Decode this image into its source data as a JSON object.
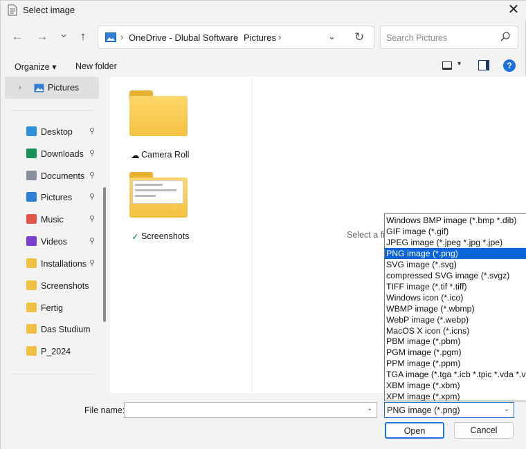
{
  "window": {
    "title": "Select image",
    "close_symbol": "✕"
  },
  "nav": {
    "back_symbol": "←",
    "forward_symbol": "→",
    "recent_symbol": "⌄",
    "up_symbol": "↑",
    "breadcrumbs": [
      "OneDrive - Dlubal Software",
      "Pictures"
    ],
    "crumb_sep": "›",
    "dropdown_symbol": "⌄",
    "refresh_symbol": "↻",
    "search_placeholder": "Search Pictures"
  },
  "command_bar": {
    "organize_label": "Organize ▾",
    "new_folder_label": "New folder",
    "view_dropdown_symbol": "▾",
    "help_symbol": "?"
  },
  "sidebar": {
    "selected": {
      "chevron": "›",
      "label": "Pictures"
    },
    "items": [
      {
        "label": "Desktop",
        "icon": "desktop-icon",
        "color": "#2f8fd8",
        "pinned": true
      },
      {
        "label": "Downloads",
        "icon": "download-icon",
        "color": "#1a8f5a",
        "pinned": true
      },
      {
        "label": "Documents",
        "icon": "document-icon",
        "color": "#8a8fa0",
        "pinned": true
      },
      {
        "label": "Pictures",
        "icon": "pictures-icon",
        "color": "#2f7fd8",
        "pinned": true
      },
      {
        "label": "Music",
        "icon": "music-icon",
        "color": "#e0574a",
        "pinned": true
      },
      {
        "label": "Videos",
        "icon": "videos-icon",
        "color": "#7b3fd0",
        "pinned": true
      },
      {
        "label": "Installations",
        "icon": "folder-icon",
        "color": "#f2c040",
        "pinned": true
      },
      {
        "label": "Screenshots",
        "icon": "folder-icon",
        "color": "#f2c040",
        "pinned": false
      },
      {
        "label": "Fertig",
        "icon": "folder-icon",
        "color": "#f2c040",
        "pinned": false
      },
      {
        "label": "Das Studium",
        "icon": "folder-icon",
        "color": "#f2c040",
        "pinned": false
      },
      {
        "label": "P_2024",
        "icon": "folder-icon",
        "color": "#f2c040",
        "pinned": false
      }
    ],
    "pin_symbol": "📌"
  },
  "main": {
    "folders": [
      {
        "label": "Camera Roll",
        "status_icon": "cloud-icon",
        "status_symbol": "☁"
      },
      {
        "label": "Screenshots",
        "status_icon": "synced-check-icon",
        "status_symbol": "✓"
      }
    ],
    "preview_text": "Select a fi"
  },
  "bottom": {
    "file_name_label": "File name:",
    "file_name_value": "",
    "file_type_value": "PNG image (*.png)",
    "open_label": "Open",
    "cancel_label": "Cancel",
    "dropdown_symbol": "⌄"
  },
  "file_types": [
    "Windows BMP image (*.bmp *.dib)",
    "GIF image (*.gif)",
    "JPEG image (*.jpeg *.jpg *.jpe)",
    "PNG image (*.png)",
    "SVG image (*.svg)",
    "compressed SVG image (*.svgz)",
    "TIFF image (*.tif *.tiff)",
    "Windows icon (*.ico)",
    "WBMP image (*.wbmp)",
    "WebP image (*.webp)",
    "MacOS X icon (*.icns)",
    "PBM image (*.pbm)",
    "PGM image (*.pgm)",
    "PPM image (*.ppm)",
    "TGA image (*.tga *.icb *.tpic *.vda *.vst)",
    "XBM image (*.xbm)",
    "XPM image (*.xpm)"
  ],
  "file_types_selected_index": 3,
  "colors": {
    "accent": "#1e73d8",
    "selection": "#0a66d8",
    "folder": "#f4c242"
  }
}
